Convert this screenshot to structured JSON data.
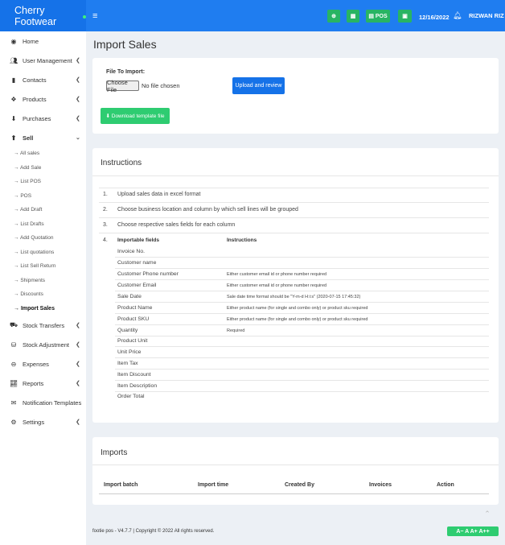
{
  "brand": {
    "title": "Cherry Footwear"
  },
  "topbar": {
    "menu_icon": "≡",
    "pos_label": "POS",
    "date": "12/16/2022",
    "user": "RIZWAN RIZ"
  },
  "sidebar": {
    "home": "Home",
    "user_management": "User Management",
    "contacts": "Contacts",
    "products": "Products",
    "purchases": "Purchases",
    "sell": "Sell",
    "sell_sub": [
      "All sales",
      "Add Sale",
      "List POS",
      "POS",
      "Add Draft",
      "List Drafts",
      "Add Quotation",
      "List quotations",
      "List Sell Return",
      "Shipments",
      "Discounts",
      "Import Sales"
    ],
    "stock_transfers": "Stock Transfers",
    "stock_adjustment": "Stock Adjustment",
    "expenses": "Expenses",
    "reports": "Reports",
    "notification_templates": "Notification Templates",
    "settings": "Settings"
  },
  "page": {
    "title": "Import Sales",
    "file_label": "File To Import:",
    "choose_file": "Choose File",
    "no_file": "No file chosen",
    "upload_button": "Upload and review",
    "download_button": "Download template file"
  },
  "instructions": {
    "title": "Instructions",
    "steps": [
      {
        "num": "1.",
        "text": "Upload sales data in excel format"
      },
      {
        "num": "2.",
        "text": "Choose business location and column by which sell lines will be grouped"
      },
      {
        "num": "3.",
        "text": "Choose respective sales fields for each column"
      },
      {
        "num": "4.",
        "text": ""
      }
    ],
    "col_fields": "Importable fields",
    "col_instructions": "Instructions",
    "fields": [
      {
        "name": "Invoice No.",
        "instr": ""
      },
      {
        "name": "Customer name",
        "instr": ""
      },
      {
        "name": "Customer Phone number",
        "instr": "Either customer email id or phone number required"
      },
      {
        "name": "Customer Email",
        "instr": "Either customer email id or phone number required"
      },
      {
        "name": "Sale Date",
        "instr": "Sale date time format should be \"Y-m-d H:i:s\" (2020-07-15 17:45:32)"
      },
      {
        "name": "Product Name",
        "instr": "Either product name (for single and combo only) or product sku required"
      },
      {
        "name": "Product SKU",
        "instr": "Either product name (for single and combo only) or product sku required"
      },
      {
        "name": "Quantity",
        "instr": "Required"
      },
      {
        "name": "Product Unit",
        "instr": ""
      },
      {
        "name": "Unit Price",
        "instr": ""
      },
      {
        "name": "Item Tax",
        "instr": ""
      },
      {
        "name": "Item Discount",
        "instr": ""
      },
      {
        "name": "Item Description",
        "instr": ""
      },
      {
        "name": "Order Total",
        "instr": ""
      }
    ]
  },
  "imports": {
    "title": "Imports",
    "columns": [
      "Import batch",
      "Import time",
      "Created By",
      "Invoices",
      "Action"
    ]
  },
  "footer": {
    "text": "footie pos - V4.7.7 | Copyright © 2022 All rights reserved.",
    "font_buttons": "A− A A+ A++"
  }
}
